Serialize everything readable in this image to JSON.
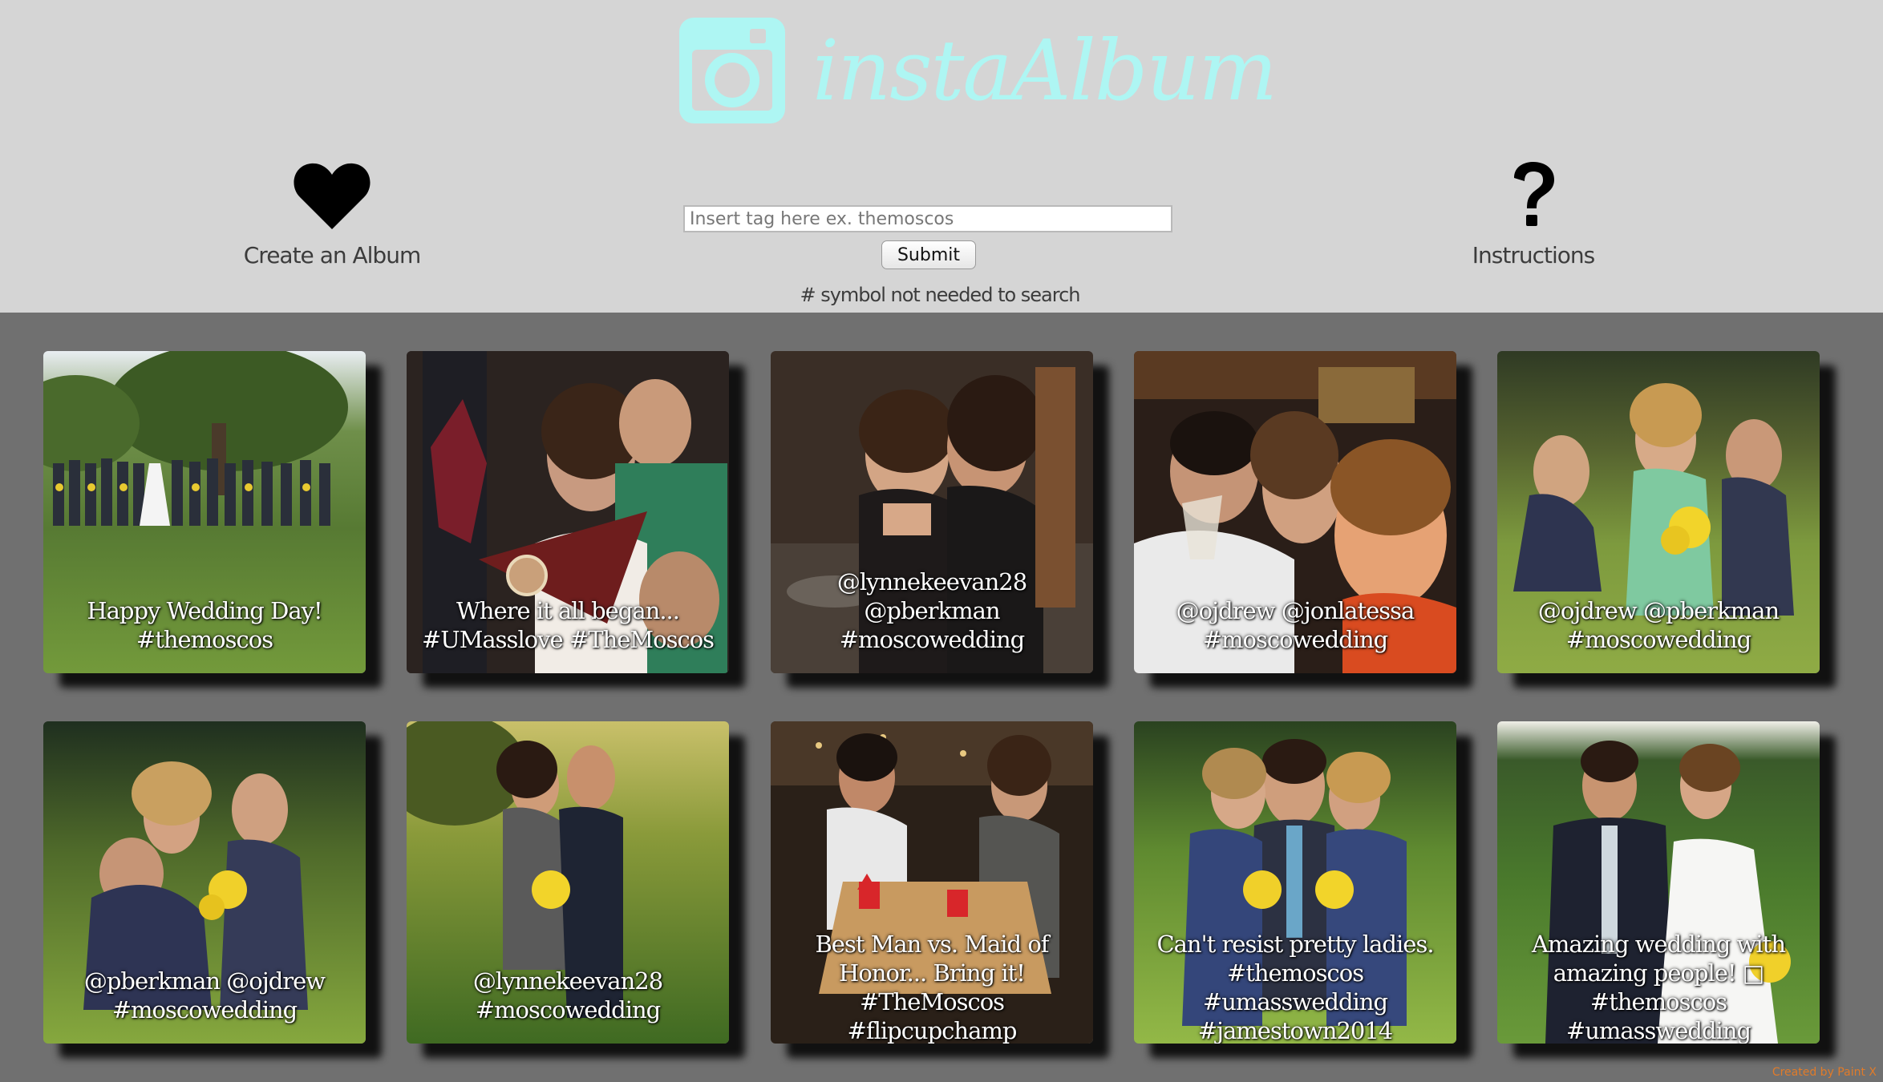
{
  "header": {
    "logo_text": "instaAlbum",
    "logo_color": "#aef6f3",
    "create_album": {
      "label": "Create an Album",
      "icon": "heart-icon"
    },
    "instructions": {
      "label": "Instructions",
      "icon": "question-mark-icon"
    },
    "search": {
      "placeholder": "Insert tag here ex. themoscos",
      "value": "",
      "submit_label": "Submit",
      "hint": "# symbol not needed to search"
    }
  },
  "gallery": {
    "photos": [
      {
        "caption": "Happy Wedding Day! #themoscos",
        "scene": "wedding party lined up on lawn under tree"
      },
      {
        "caption": "Where it all began... #UMasslove #TheMoscos",
        "scene": "bride with friends holding UMass pennant"
      },
      {
        "caption": "@lynnekeevan28 @pberkman #moscowedding",
        "scene": "two women posing indoors"
      },
      {
        "caption": "@ojdrew @jonlatessa #moscowedding",
        "scene": "friends toasting at reception"
      },
      {
        "caption": "@ojdrew @pberkman #moscowedding",
        "scene": "bridesmaids with bouquets on lawn"
      },
      {
        "caption": "@pberkman @ojdrew #moscowedding",
        "scene": "bridesmaids posing with sunflowers"
      },
      {
        "caption": "@lynnekeevan28 #moscowedding",
        "scene": "couple posing on grass at sunset"
      },
      {
        "caption": "Best Man vs. Maid of Honor... Bring it! #TheMoscos #flipcupchamp",
        "scene": "flip cup game at reception table"
      },
      {
        "caption": "Can't resist pretty ladies. #themoscos #umasswedding #jamestown2014",
        "scene": "groom kissed by two bridesmaids"
      },
      {
        "caption": "Amazing wedding with amazing people! □ #themoscos #umasswedding",
        "scene": "bride and groom on lawn"
      }
    ]
  },
  "footer": {
    "credit": "Created by Paint X"
  }
}
